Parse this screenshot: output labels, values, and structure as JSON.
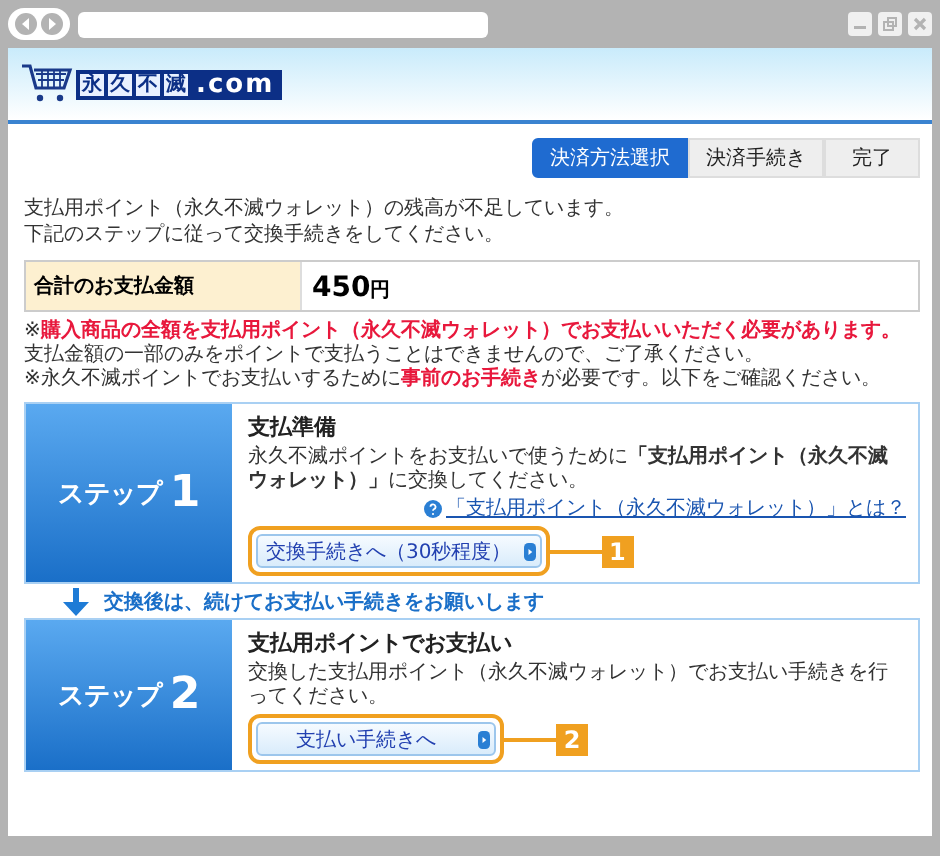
{
  "logo": {
    "boxed": "永久不滅",
    "suffix": ".com"
  },
  "progress": [
    {
      "label": "決済方法選択",
      "selected": true
    },
    {
      "label": "決済手続き",
      "selected": false
    },
    {
      "label": "完了",
      "selected": false
    }
  ],
  "intro": [
    "支払用ポイント（永久不滅ウォレット）の残高が不足しています。",
    "下記のステップに従って交換手続きをしてください。"
  ],
  "total": {
    "label": "合計のお支払金額",
    "amount": "450",
    "unit": "円"
  },
  "notes": [
    "※**購入商品の全額を支払用ポイント（永久不滅ウォレット）でお支払いいただく必要があります。**支払金額の一部のみをポイントで支払うことはできませんので、ご了承ください。",
    "※永久不滅ポイントでお支払いするために**事前のお手続き**が必要です。以下をご確認ください。"
  ],
  "steps": [
    {
      "label": "ステップ",
      "number": "1",
      "title": "支払準備",
      "description": "永久不滅ポイントをお支払いで使うために**「支払用ポイント（永久不滅ウォレット）」**に交換してください。",
      "help_link": "「支払用ポイント（永久不滅ウォレット）」とは？",
      "button": "交換手続きへ（30秒程度）",
      "callout": "1"
    },
    {
      "label": "ステップ",
      "number": "2",
      "title": "支払用ポイントでお支払い",
      "description": "交換した支払用ポイント（永久不滅ウォレット）でお支払い手続きを行ってください。",
      "button": "支払い手続きへ",
      "callout": "2"
    }
  ],
  "between_steps": "交換後は、続けてお支払い手続きをお願いします"
}
